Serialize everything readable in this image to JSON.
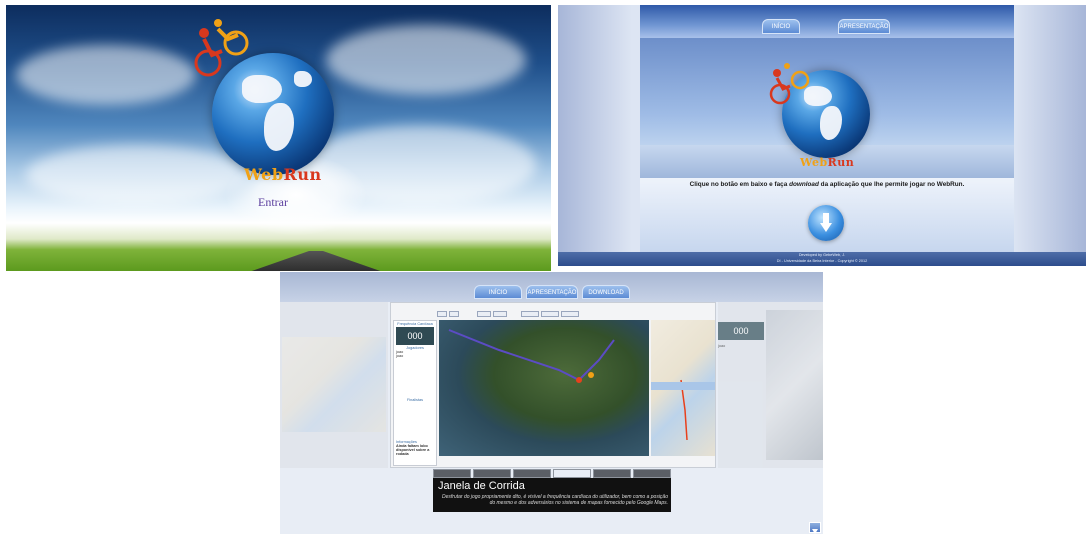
{
  "panel1": {
    "logo": {
      "part1": "Web",
      "part2": "Run"
    },
    "enter_link": "Entrar"
  },
  "panel2": {
    "tabs": [
      "INÍCIO",
      "APRESENTAÇÃO"
    ],
    "logo": {
      "part1": "Web",
      "part2": "Run"
    },
    "message_before": "Clique no botão em baixo e faça ",
    "message_em": "download",
    "message_after": " da aplicação que lhe permite jogar no WebRun.",
    "footer_line1": "Developed by GebeWeb, J.",
    "footer_line2": "DI - Universidade da Beira Interior - Copyright © 2012",
    "download_icon": "download-arrow-icon"
  },
  "panel3": {
    "tabs": [
      "INÍCIO",
      "APRESENTAÇÃO",
      "DOWNLOAD"
    ],
    "app": {
      "heart_label": "Frequência Cardíaca",
      "heart_value": "000",
      "players_label": "Jogadores",
      "players": [
        "joao",
        "joao"
      ],
      "finished_label": "Finalistas",
      "info_label": "Informações",
      "info_text": "Ainda faltam lobo disponível sobre a rodada"
    },
    "right_app": {
      "heart_label": "Frequência Cardíaca",
      "heart_value": "000",
      "players_label": "Jogadores",
      "player": "joao"
    },
    "caption_title": "Janela de Corrida",
    "caption_text": "Desfrutar do jogo propriamente dito, é visível a frequência cardíaca do utilizador, bem como a posição do mesmo e dos adversários no sistema de mapas fornecido pelo Google Maps."
  },
  "colors": {
    "logo_orange": "#f0a116",
    "logo_red": "#d9381e",
    "link_purple": "#5b3e9e",
    "tab_blue": "#5c8bd4"
  }
}
